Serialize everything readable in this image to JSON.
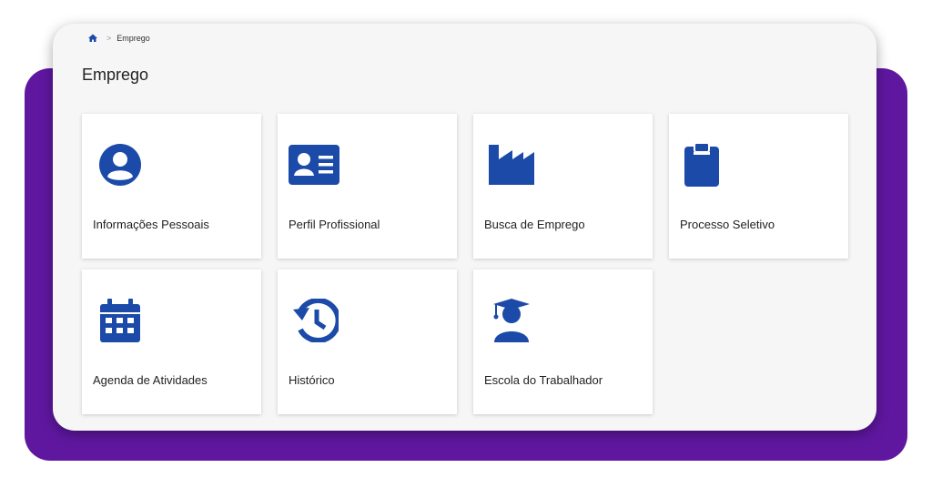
{
  "breadcrumb": {
    "home_icon": "home-icon",
    "separator_icon": "chevron-right-icon",
    "current": "Emprego"
  },
  "page": {
    "title": "Emprego"
  },
  "colors": {
    "accent": "#1b4aa8",
    "brand_purple": "#5f17a0"
  },
  "cards": [
    {
      "label": "Informações Pessoais",
      "icon": "user-circle-icon"
    },
    {
      "label": "Perfil Profissional",
      "icon": "id-card-icon"
    },
    {
      "label": "Busca de Emprego",
      "icon": "factory-icon"
    },
    {
      "label": "Processo Seletivo",
      "icon": "clipboard-icon"
    },
    {
      "label": "Agenda de Atividades",
      "icon": "calendar-icon"
    },
    {
      "label": "Histórico",
      "icon": "history-icon"
    },
    {
      "label": "Escola do Trabalhador",
      "icon": "graduate-icon"
    }
  ]
}
